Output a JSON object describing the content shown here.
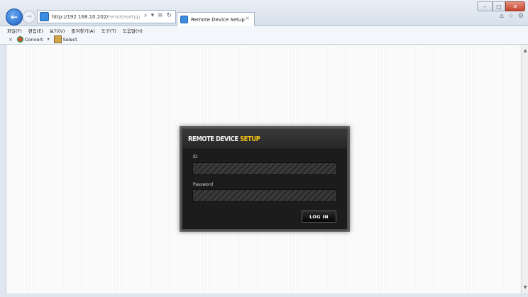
{
  "browser": {
    "url_host": "http://192.168.10.202/",
    "url_path": "remotesetup",
    "address_tools": "⌕ ▾ ≡ ↻",
    "tab_title": "Remote Device Setup",
    "tab_close": "×"
  },
  "window_controls": {
    "minimize": "–",
    "maximize": "□",
    "close": "✕"
  },
  "menu": [
    "파일(F)",
    "편집(E)",
    "보기(V)",
    "즐겨찾기(A)",
    "도구(T)",
    "도움말(H)"
  ],
  "command_bar": {
    "close": "×",
    "convert_label": "Convert",
    "dropdown": "▾",
    "select_label": "Select"
  },
  "login": {
    "title_main": "REMOTE DEVICE ",
    "title_accent": "SETUP",
    "id_label": "ID",
    "password_label": "Password",
    "login_button": "LOG IN"
  },
  "colors": {
    "accent": "#f4c21b",
    "dialog_bg": "#1c1c1c",
    "ie_blue": "#1d62c8"
  },
  "icons": [
    "back-icon",
    "forward-icon",
    "page-icon",
    "home-icon",
    "star-icon",
    "gear-icon",
    "convert-icon",
    "select-icon"
  ]
}
